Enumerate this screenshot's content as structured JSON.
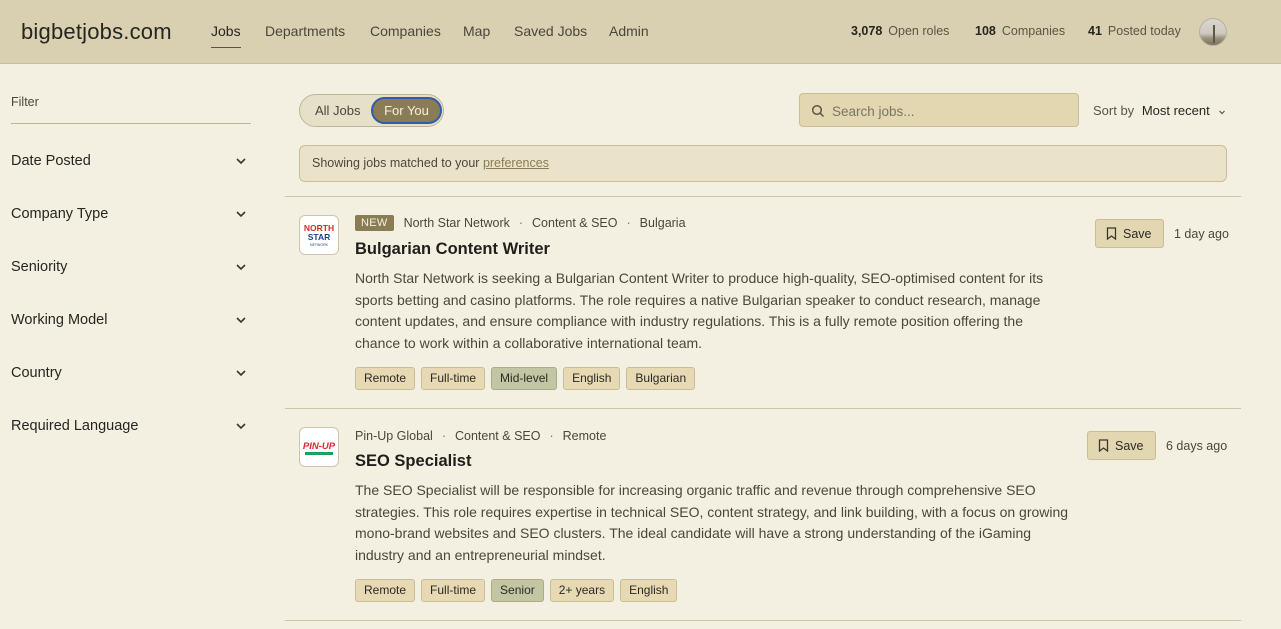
{
  "header": {
    "logo": "bigbetjobs.com",
    "nav": [
      "Jobs",
      "Departments",
      "Companies",
      "Map",
      "Saved Jobs",
      "Admin"
    ],
    "active_nav": "Jobs",
    "stats": [
      {
        "value": "3,078",
        "label": "Open roles"
      },
      {
        "value": "108",
        "label": "Companies"
      },
      {
        "value": "41",
        "label": "Posted today"
      }
    ]
  },
  "sidebar": {
    "title": "Filter",
    "filters": [
      "Date Posted",
      "Company Type",
      "Seniority",
      "Working Model",
      "Country",
      "Required Language"
    ]
  },
  "toolbar": {
    "toggle_all": "All Jobs",
    "toggle_you": "For You",
    "toggle_selected": "For You",
    "search_placeholder": "Search jobs...",
    "sort_label": "Sort by",
    "sort_value": "Most recent"
  },
  "banner": {
    "text": "Showing jobs matched to your ",
    "link": "preferences"
  },
  "jobs": [
    {
      "badge": "NEW",
      "company": "North Star Network",
      "department": "Content & SEO",
      "location": "Bulgaria",
      "title": "Bulgarian Content Writer",
      "description": "North Star Network is seeking a Bulgarian Content Writer to produce high-quality, SEO-optimised content for its sports betting and casino platforms. The role requires a native Bulgarian speaker to conduct research, manage content updates, and ensure compliance with industry regulations. This is a fully remote position offering the chance to work within a collaborative international team.",
      "tags": [
        "Remote",
        "Full-time",
        "Mid-level",
        "English",
        "Bulgarian"
      ],
      "highlight_tag": "Mid-level",
      "save_label": "Save",
      "posted": "1 day ago",
      "logo_text": [
        "NORTH",
        "STAR",
        "NETWORK"
      ]
    },
    {
      "badge": "",
      "company": "Pin-Up Global",
      "department": "Content & SEO",
      "location": "Remote",
      "title": "SEO Specialist",
      "description": "The SEO Specialist will be responsible for increasing organic traffic and revenue through comprehensive SEO strategies. This role requires expertise in technical SEO, content strategy, and link building, with a focus on growing mono-brand websites and SEO clusters. The ideal candidate will have a strong understanding of the iGaming industry and an entrepreneurial mindset.",
      "tags": [
        "Remote",
        "Full-time",
        "Senior",
        "2+ years",
        "English"
      ],
      "highlight_tag": "Senior",
      "save_label": "Save",
      "posted": "6 days ago",
      "logo_text": [
        "PIN-UP"
      ]
    }
  ],
  "colors": {
    "header_bg": "#d8d0b0",
    "page_bg": "#f4f0e1",
    "accent": "#8a7c55",
    "focus_ring": "#2f5dab",
    "tag_bg": "#e6d9b3",
    "tag_highlight_bg": "#c2c6a2"
  }
}
